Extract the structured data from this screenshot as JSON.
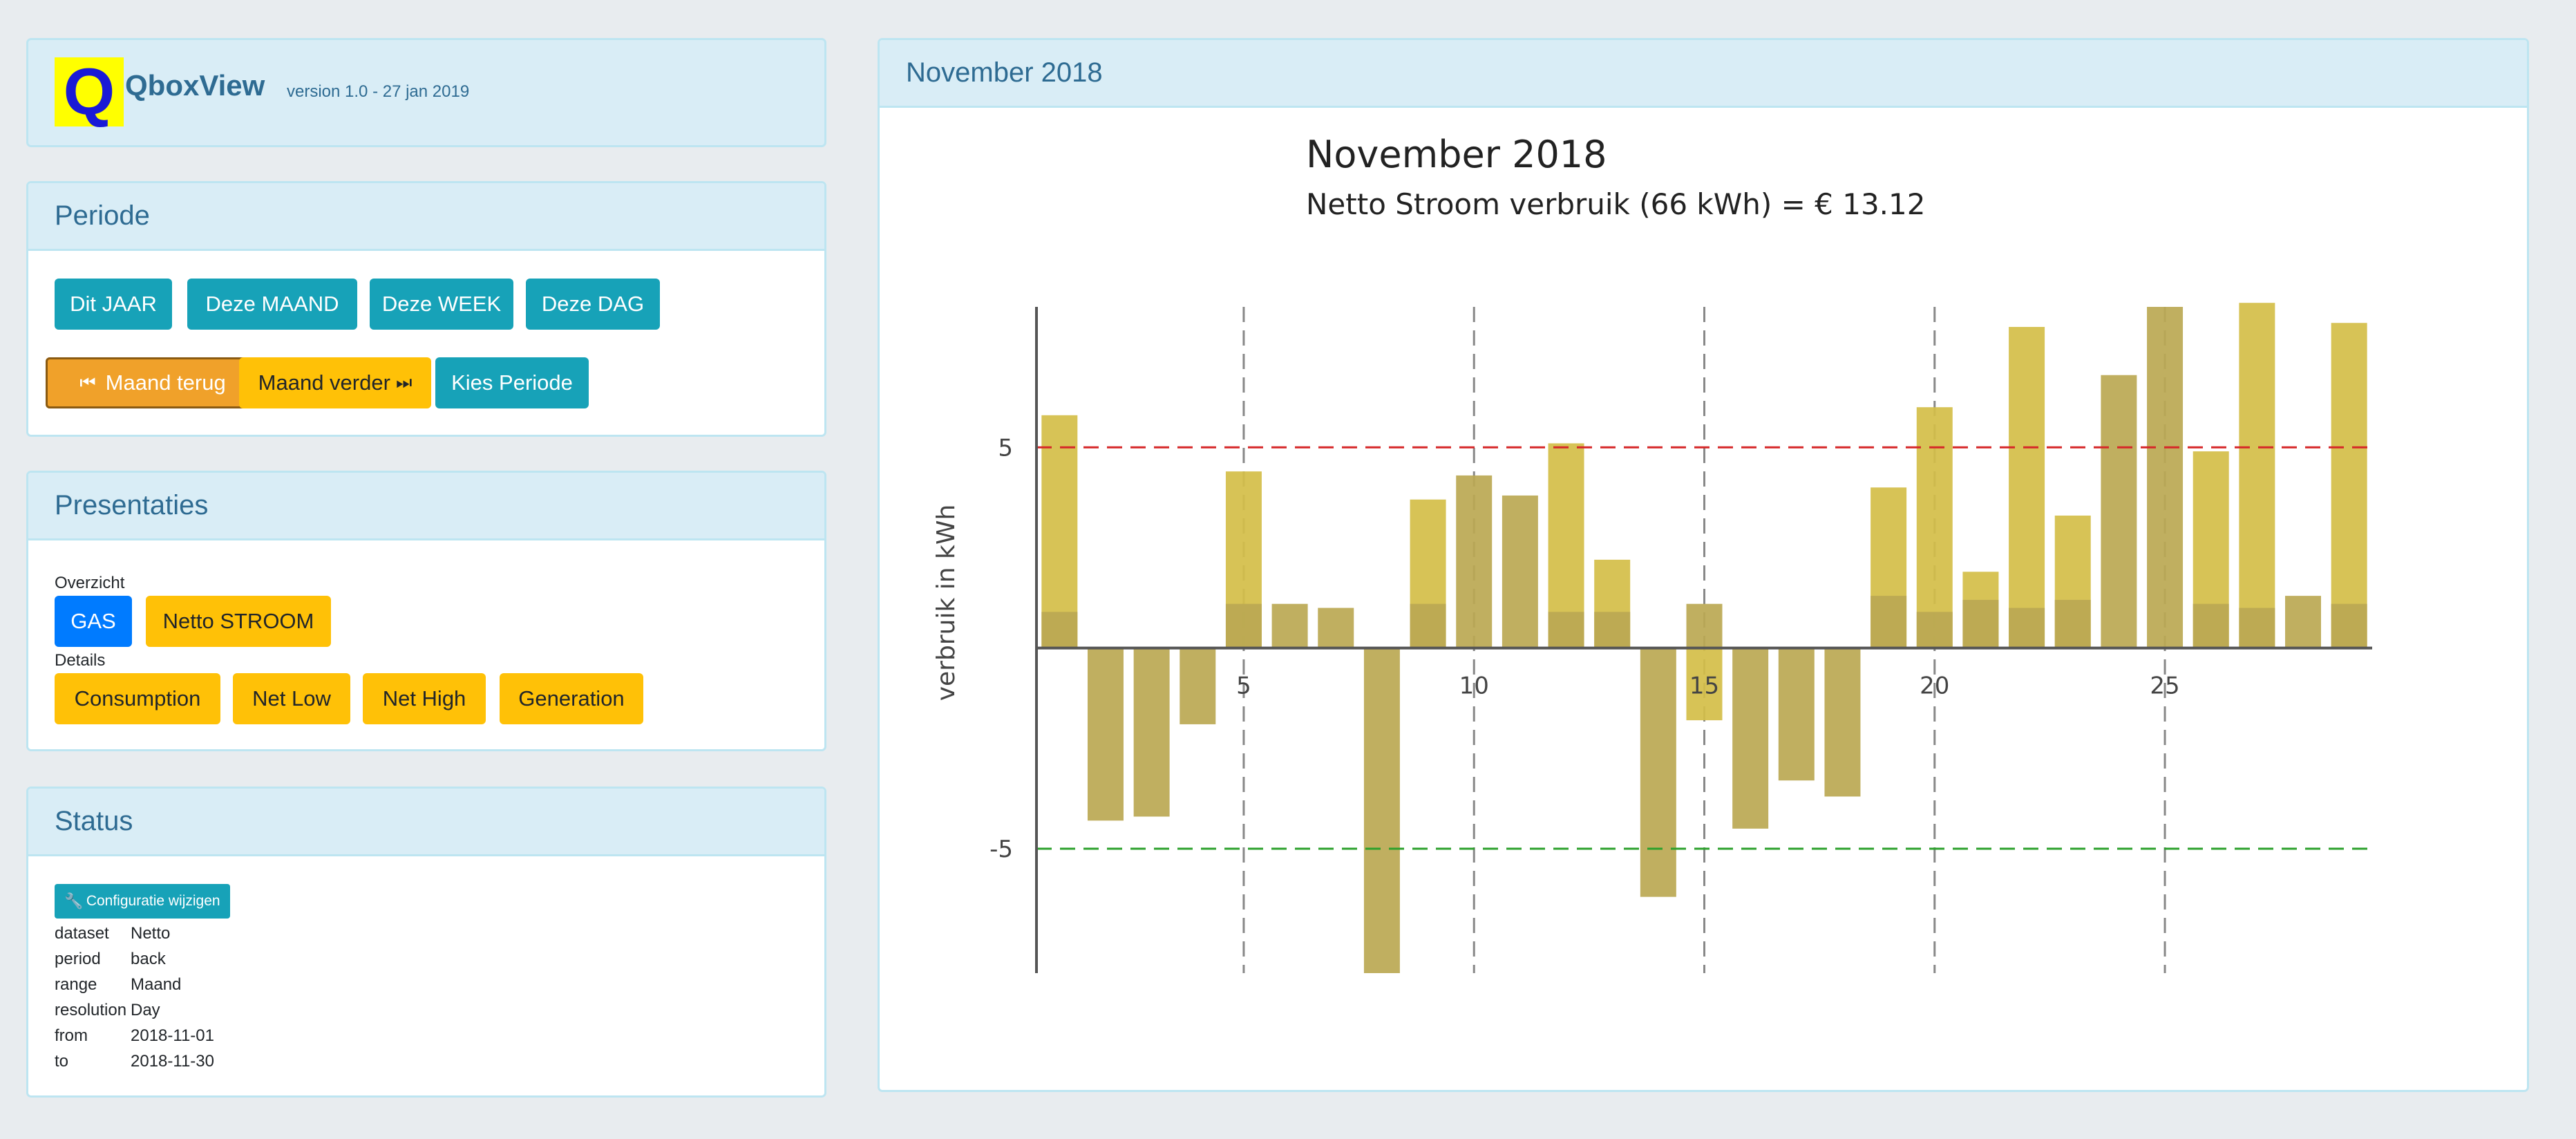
{
  "header": {
    "app_name": "QboxView",
    "version": "version 1.0 - 27 jan 2019",
    "logo_letter": "Q",
    "logo_bg": "#ffff00",
    "logo_fg": "#1a1ad6"
  },
  "periode": {
    "title": "Periode",
    "buttons": [
      "Dit JAAR",
      "Deze MAAND",
      "Deze WEEK",
      "Deze DAG"
    ],
    "back": "Maand terug",
    "forward": "Maand verder",
    "choose": "Kies Periode"
  },
  "presentaties": {
    "title": "Presentaties",
    "overview_label": "Overzicht",
    "overview": [
      "GAS",
      "Netto STROOM"
    ],
    "details_label": "Details",
    "details": [
      "Consumption",
      "Net Low",
      "Net High",
      "Generation"
    ]
  },
  "status": {
    "title": "Status",
    "config_button": "Configuratie wijzigen",
    "rows": [
      {
        "key": "dataset",
        "value": "Netto"
      },
      {
        "key": "period",
        "value": "back"
      },
      {
        "key": "range",
        "value": "Maand"
      },
      {
        "key": "resolution",
        "value": "Day"
      },
      {
        "key": "from",
        "value": "2018-11-01"
      },
      {
        "key": "to",
        "value": "2018-11-30"
      }
    ]
  },
  "chart_panel": {
    "title": "November 2018"
  },
  "colors": {
    "bar_light": "#d4be48",
    "bar_dark": "#bba852",
    "ref_upper": "#d62728",
    "ref_lower": "#2ca02c",
    "teal": "#17a2b8",
    "yellow": "#ffc107"
  },
  "chart_data": {
    "type": "bar",
    "title": "November 2018",
    "subtitle": "Netto Stroom verbruik (66 kWh) = € 13.12",
    "ylabel": "verbruik in kWh",
    "xlabel": "",
    "x": [
      1,
      2,
      3,
      4,
      5,
      6,
      7,
      8,
      9,
      10,
      11,
      12,
      13,
      14,
      15,
      16,
      17,
      18,
      19,
      20,
      21,
      22,
      23,
      24,
      25,
      26,
      27,
      28,
      29
    ],
    "series": [
      {
        "values": [
          5.8,
          0.0,
          0.0,
          0.0,
          4.4,
          0.0,
          0.0,
          0.0,
          3.7,
          0.0,
          0.0,
          5.1,
          2.2,
          0.0,
          -1.8,
          0.0,
          0.0,
          0.0,
          4.0,
          6.0,
          1.9,
          8.0,
          3.3,
          0.0,
          0.0,
          4.9,
          8.6,
          0.0,
          8.1
        ]
      },
      {
        "values": [
          0.9,
          -4.3,
          -4.2,
          -1.9,
          1.1,
          1.1,
          1.0,
          -8.1,
          1.1,
          4.3,
          3.8,
          0.9,
          0.9,
          -6.2,
          1.1,
          -4.5,
          -3.3,
          -3.7,
          1.3,
          0.9,
          1.2,
          1.0,
          1.2,
          6.8,
          8.5,
          1.1,
          1.0,
          1.3,
          1.1
        ]
      }
    ],
    "x_ticks": [
      5,
      10,
      15,
      20,
      25
    ],
    "y_ticks": [
      -5,
      5
    ],
    "vlines": [
      5,
      10,
      15,
      20,
      25
    ],
    "hlines": [
      5,
      -5
    ],
    "xlim": [
      0.5,
      29.5
    ],
    "ylim": [
      -8.1,
      8.5
    ],
    "grid": false
  }
}
